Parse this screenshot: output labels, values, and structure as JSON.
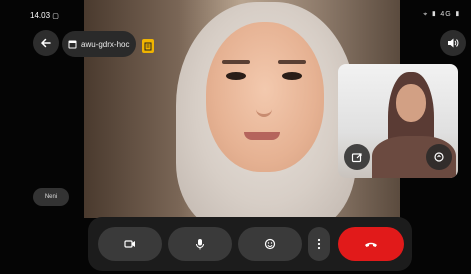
{
  "status_bar": {
    "time": "14.03",
    "right_indicators": "⌖ ▮ 4G ▮"
  },
  "header": {
    "meeting_code": "awu-gdrx-hoc",
    "back_icon": "arrow-left-icon",
    "calendar_icon": "calendar-icon",
    "badge_icon": "shield-icon",
    "speaker_icon": "speaker-icon"
  },
  "participant": {
    "name": "Neni"
  },
  "self_view": {
    "share_icon": "share-screen-icon",
    "switch_camera_icon": "switch-camera-icon"
  },
  "controls": {
    "camera_icon": "video-camera-icon",
    "mic_icon": "microphone-icon",
    "emoji_icon": "emoji-icon",
    "more_icon": "more-vertical-icon",
    "end_call_icon": "end-call-icon"
  },
  "colors": {
    "background": "#050505",
    "control_bar": "#1c1c1c",
    "control_button": "#3a3a3a",
    "end_call": "#e11a1a",
    "badge": "#f0b400"
  }
}
